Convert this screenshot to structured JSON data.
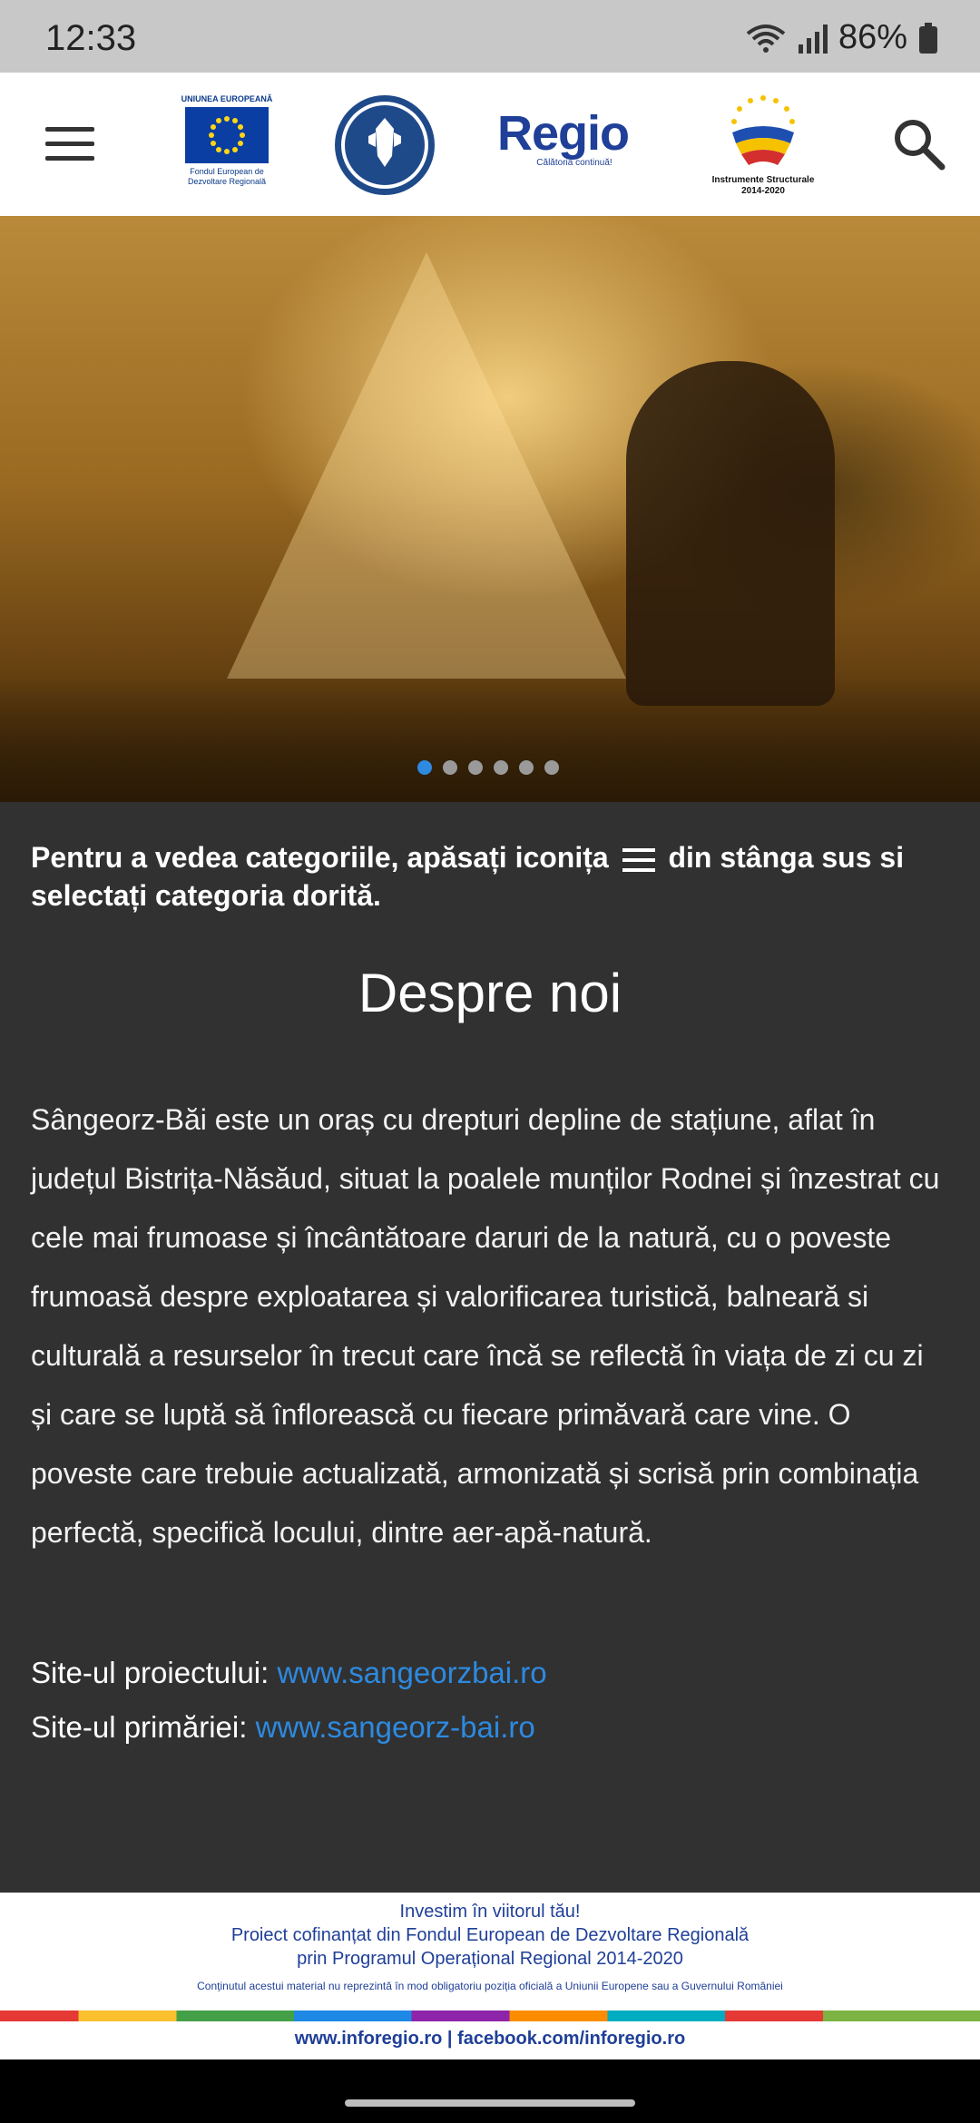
{
  "status": {
    "time": "12:33",
    "battery": "86%"
  },
  "header": {
    "eu_logo": {
      "caption": "UNIUNEA EUROPEANĂ",
      "subtitle_1": "Fondul European de",
      "subtitle_2": "Dezvoltare Regională"
    },
    "regio_logo": {
      "word": "Regio",
      "tagline": "Călătoria continuă!"
    },
    "is_logo": {
      "caption_1": "Instrumente Structurale",
      "caption_2": "2014-2020"
    }
  },
  "hero": {
    "slide_count": 6,
    "active_slide": 1
  },
  "content": {
    "hint_before": "Pentru a vedea categoriile, apăsați iconița",
    "hint_after": "din stânga sus si selectați categoria dorită.",
    "title": "Despre noi",
    "paragraph": "Sângeorz-Băi este un oraș cu drepturi depline de stațiune, aflat în județul Bistrița-Năsăud, situat la poalele munților Rodnei și înzestrat cu cele mai frumoase și încântătoare daruri de la natură, cu o poveste frumoasă despre exploatarea și valorificarea turistică, balneară si culturală a resurselor în trecut care încă se reflectă în viața de zi cu zi și care se luptă să înflorească cu fiecare primăvară care vine. O poveste care trebuie actualizată, armonizată și scrisă prin combinația perfectă, specifică locului, dintre aer-apă-natură.",
    "project_site_label": "Site-ul proiectului:",
    "project_site_link": "www.sangeorzbai.ro",
    "townhall_site_label": "Site-ul primăriei:",
    "townhall_site_link": "www.sangeorz-bai.ro"
  },
  "footer": {
    "line1": "Investim în viitorul tău!",
    "line2": "Proiect cofinanțat din Fondul European de Dezvoltare Regională",
    "line3": "prin Programul Operațional Regional 2014-2020",
    "disclaimer": "Conținutul acestui material nu reprezintă în mod obligatoriu poziția oficială a Uniunii Europene sau a Guvernului României",
    "links": "www.inforegio.ro   |   facebook.com/inforegio.ro"
  },
  "colors": {
    "accent_link": "#2d8ae0",
    "content_bg": "#313131",
    "brand_blue": "#1f3f98"
  },
  "icons": [
    "menu-icon",
    "search-icon",
    "wifi-icon",
    "signal-icon",
    "battery-icon"
  ]
}
